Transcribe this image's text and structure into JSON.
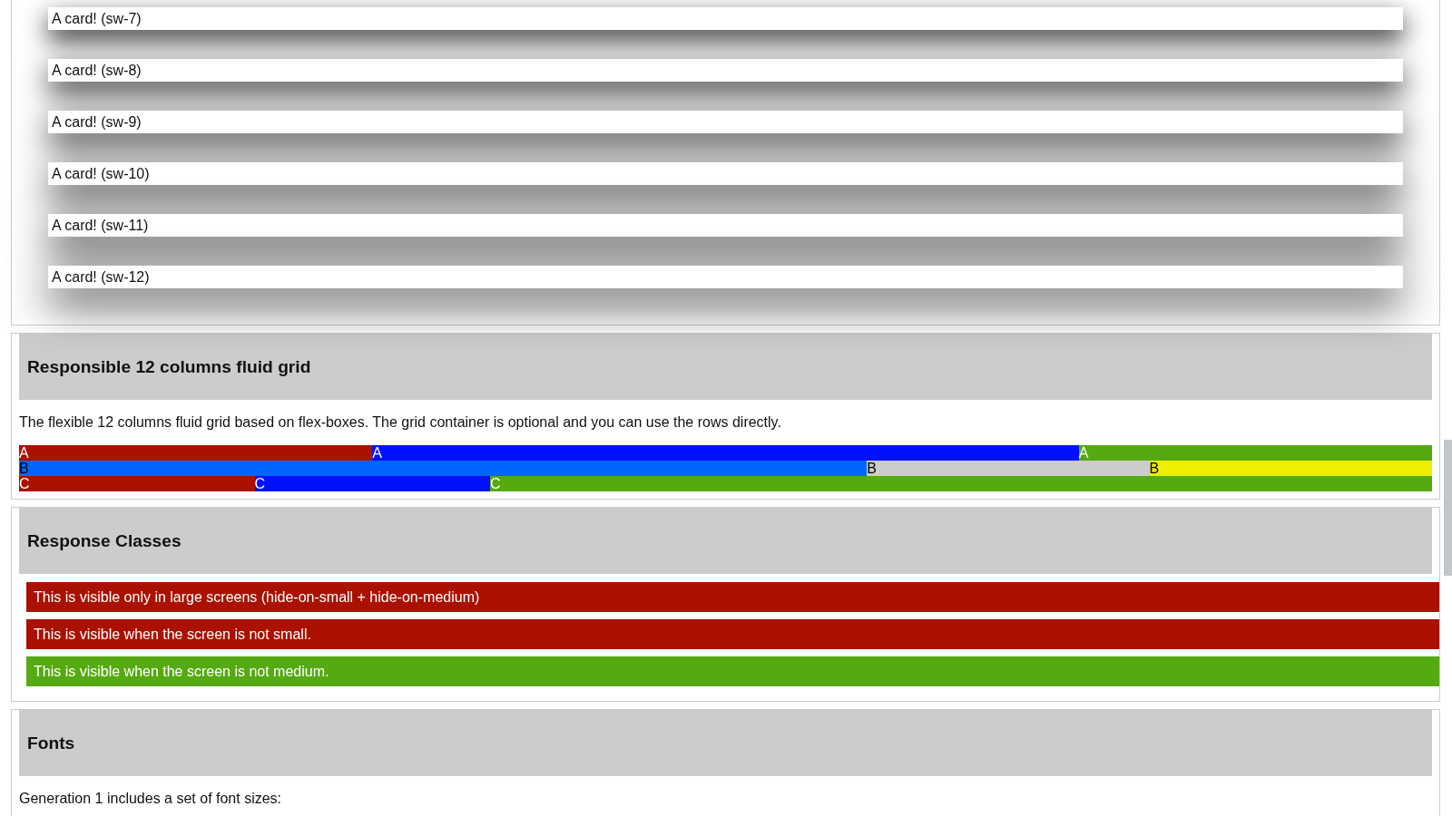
{
  "sections": [
    {
      "kind": "cards",
      "cards": [
        "A card! (sw-7)",
        "A card! (sw-8)",
        "A card! (sw-9)",
        "A card! (sw-10)",
        "A card! (sw-11)",
        "A card! (sw-12)"
      ]
    },
    {
      "kind": "grid",
      "title": "Responsible 12 columns fluid grid",
      "text": "The flexible 12 columns fluid grid based on flex-boxes. The grid container is optional and you can use the rows directly.",
      "rows": [
        {
          "kind": "light",
          "cells": [
            {
              "label": "A",
              "color": "#aa1100",
              "kind": "quarter"
            },
            {
              "label": "A",
              "color": "#0011ff",
              "kind": "half"
            },
            {
              "label": "A",
              "color": "#55aa11",
              "kind": "quarter"
            }
          ]
        },
        {
          "kind": "dark",
          "cells": [
            {
              "label": "B",
              "color": "#0066ff",
              "kind": "three-fifths"
            },
            {
              "label": "B",
              "color": "#cccccc",
              "kind": "fifth"
            },
            {
              "label": "B",
              "color": "#eeee00",
              "kind": "fifth"
            }
          ]
        },
        {
          "kind": "light",
          "cells": [
            {
              "label": "C",
              "color": "#aa1100",
              "kind": "sixth"
            },
            {
              "label": "C",
              "color": "#0011ff",
              "kind": "sixth"
            },
            {
              "label": "C",
              "color": "#55aa11",
              "kind": "two-thirds"
            }
          ]
        }
      ]
    },
    {
      "kind": "bars",
      "title": "Response Classes",
      "bars": [
        {
          "text": "This is visible only in large screens (hide-on-small + hide-on-medium)",
          "color": "#aa1100"
        },
        {
          "text": "This is visible when the screen is not small.",
          "color": "#aa1100"
        },
        {
          "text": "This is visible when the screen is not medium.",
          "color": "#55aa11"
        }
      ]
    },
    {
      "kind": "text",
      "title": "Fonts",
      "text": "Generation 1 includes a set of font sizes:"
    }
  ]
}
